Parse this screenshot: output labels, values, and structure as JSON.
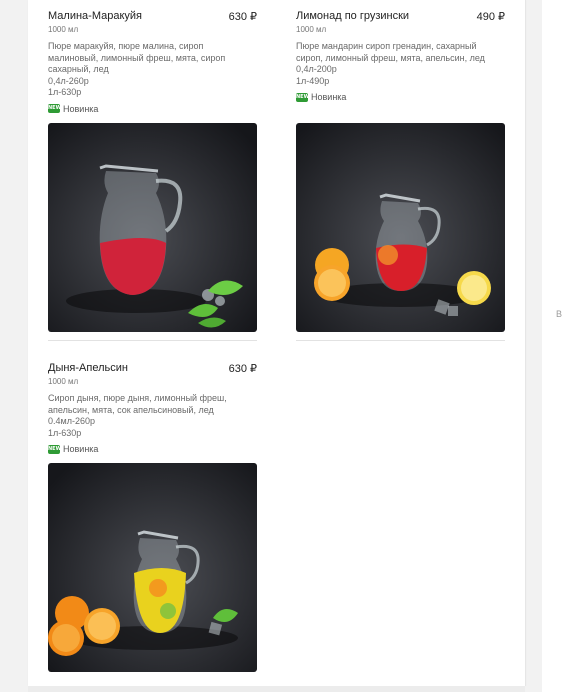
{
  "products": [
    {
      "name": "Малина-Маракуйя",
      "price": "630 ₽",
      "volume": "1000 мл",
      "description": [
        "Пюре маракуйя, пюре малина, сироп",
        "малиновый, лимонный фреш, мята, сироп",
        "сахарный, лед"
      ],
      "sizes": [
        "0,4л-260р",
        "1л-630р"
      ],
      "badge_icon": "NEW",
      "badge": "Новинка",
      "drink_color": "#d0233a"
    },
    {
      "name": "Лимонад по грузински",
      "price": "490 ₽",
      "volume": "1000 мл",
      "description": [
        "Пюре мандарин сироп гренадин, сахарный",
        "сироп, лимонный фреш, мята, апельсин, лед"
      ],
      "sizes": [
        "0,4л-200р",
        "1л-490р"
      ],
      "badge_icon": "NEW",
      "badge": "Новинка",
      "drink_color": "#d81f2a"
    },
    {
      "name": "Дыня-Апельсин",
      "price": "630 ₽",
      "volume": "1000 мл",
      "description": [
        "Сироп дыня, пюре дыня, лимонный фреш,",
        "апельсин, мята, сок апельсиновый, лед"
      ],
      "sizes": [
        "0.4мл-260р",
        "1л-630р"
      ],
      "badge_icon": "NEW",
      "badge": "Новинка",
      "drink_color": "#e9d21e"
    }
  ],
  "edge_text": "В"
}
